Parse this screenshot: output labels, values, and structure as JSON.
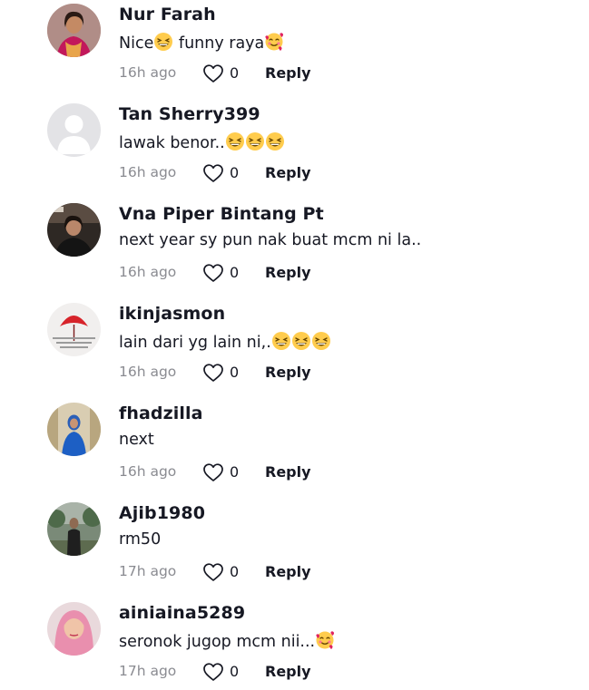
{
  "comments": [
    {
      "username": "Nur Farah",
      "text_before": "Nice",
      "text_mid": " funny raya",
      "time": "16h ago",
      "likes": "0",
      "reply_label": "Reply",
      "avatar": "woman-pink-outfit",
      "emojis_mid": [
        "grinning-squint-emoji"
      ],
      "emojis_end": [
        "smiling-hearts-emoji"
      ]
    },
    {
      "username": "Tan Sherry399",
      "text_before": "lawak benor..",
      "time": "16h ago",
      "likes": "0",
      "reply_label": "Reply",
      "avatar": "default-silhouette",
      "emojis_end": [
        "grinning-squint-emoji",
        "grinning-squint-emoji",
        "grinning-squint-emoji"
      ]
    },
    {
      "username": "Vna Piper Bintang Pt",
      "text_before": "next year sy pun nak buat mcm ni la..",
      "time": "16h ago",
      "likes": "0",
      "reply_label": "Reply",
      "avatar": "woman-dark-photo"
    },
    {
      "username": "ikinjasmon",
      "text_before": "lain dari yg lain ni,.",
      "time": "16h ago",
      "likes": "0",
      "reply_label": "Reply",
      "avatar": "red-umbrella-quote",
      "emojis_end": [
        "grinning-squint-emoji",
        "grinning-squint-emoji",
        "grinning-squint-emoji"
      ]
    },
    {
      "username": "fhadzilla",
      "text_before": "next",
      "time": "16h ago",
      "likes": "0",
      "reply_label": "Reply",
      "avatar": "woman-blue-dress"
    },
    {
      "username": "Ajib1980",
      "text_before": "rm50",
      "time": "17h ago",
      "likes": "0",
      "reply_label": "Reply",
      "avatar": "man-outdoor-trees"
    },
    {
      "username": "ainiaina5289",
      "text_before": "seronok jugop mcm nii...",
      "time": "17h ago",
      "likes": "0",
      "reply_label": "Reply",
      "avatar": "woman-pink-hijab",
      "emojis_end": [
        "smiling-hearts-emoji"
      ]
    }
  ],
  "colors": {
    "text": "#161823",
    "muted": "#8a8b91"
  }
}
